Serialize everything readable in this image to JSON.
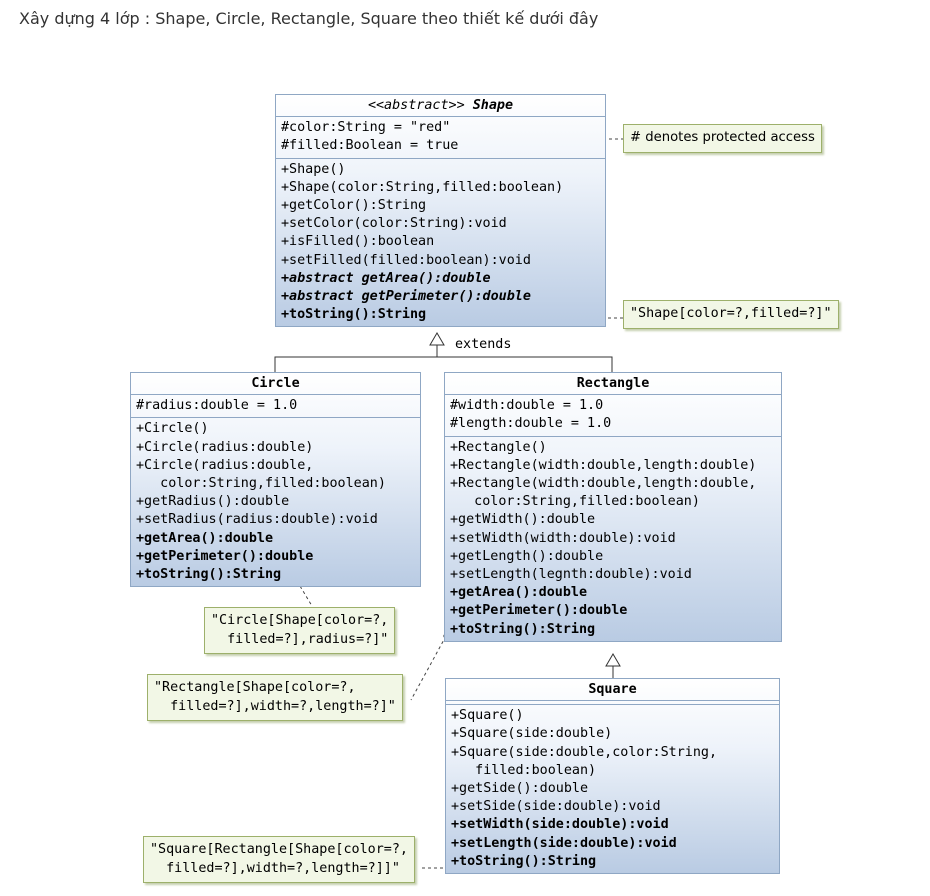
{
  "heading": "Xây dựng 4 lớp : Shape, Circle, Rectangle, Square theo thiết kế dưới đây",
  "shape": {
    "stereotype": "<<abstract>>",
    "name": "Shape",
    "attributes": [
      "#color:String = \"red\"",
      "#filled:Boolean = true"
    ],
    "methods": [
      {
        "text": "+Shape()",
        "style": ""
      },
      {
        "text": "+Shape(color:String,filled:boolean)",
        "style": ""
      },
      {
        "text": "+getColor():String",
        "style": ""
      },
      {
        "text": "+setColor(color:String):void",
        "style": ""
      },
      {
        "text": "+isFilled():boolean",
        "style": ""
      },
      {
        "text": "+setFilled(filled:boolean):void",
        "style": ""
      },
      {
        "text": "+abstract getArea():double",
        "style": "bi"
      },
      {
        "text": "+abstract getPerimeter():double",
        "style": "bi"
      },
      {
        "text": "+toString():String",
        "style": "b"
      }
    ]
  },
  "circle": {
    "name": "Circle",
    "attributes": [
      "#radius:double = 1.0"
    ],
    "methods": [
      {
        "text": "+Circle()",
        "style": ""
      },
      {
        "text": "+Circle(radius:double)",
        "style": ""
      },
      {
        "text": "+Circle(radius:double,",
        "style": ""
      },
      {
        "text": "   color:String,filled:boolean)",
        "style": ""
      },
      {
        "text": "+getRadius():double",
        "style": ""
      },
      {
        "text": "+setRadius(radius:double):void",
        "style": ""
      },
      {
        "text": "+getArea():double",
        "style": "b"
      },
      {
        "text": "+getPerimeter():double",
        "style": "b"
      },
      {
        "text": "+toString():String",
        "style": "b"
      }
    ]
  },
  "rectangle": {
    "name": "Rectangle",
    "attributes": [
      "#width:double = 1.0",
      "#length:double = 1.0"
    ],
    "methods": [
      {
        "text": "+Rectangle()",
        "style": ""
      },
      {
        "text": "+Rectangle(width:double,length:double)",
        "style": ""
      },
      {
        "text": "+Rectangle(width:double,length:double,",
        "style": ""
      },
      {
        "text": "   color:String,filled:boolean)",
        "style": ""
      },
      {
        "text": "+getWidth():double",
        "style": ""
      },
      {
        "text": "+setWidth(width:double):void",
        "style": ""
      },
      {
        "text": "+getLength():double",
        "style": ""
      },
      {
        "text": "+setLength(legnth:double):void",
        "style": ""
      },
      {
        "text": "+getArea():double",
        "style": "b"
      },
      {
        "text": "+getPerimeter():double",
        "style": "b"
      },
      {
        "text": "+toString():String",
        "style": "b"
      }
    ]
  },
  "square": {
    "name": "Square",
    "methods": [
      {
        "text": "+Square()",
        "style": ""
      },
      {
        "text": "+Square(side:double)",
        "style": ""
      },
      {
        "text": "+Square(side:double,color:String,",
        "style": ""
      },
      {
        "text": "   filled:boolean)",
        "style": ""
      },
      {
        "text": "+getSide():double",
        "style": ""
      },
      {
        "text": "+setSide(side:double):void",
        "style": ""
      },
      {
        "text": "+setWidth(side:double):void",
        "style": "b"
      },
      {
        "text": "+setLength(side:double):void",
        "style": "b"
      },
      {
        "text": "+toString():String",
        "style": "b"
      }
    ]
  },
  "notes": {
    "protected": "# denotes protected access",
    "shape_tostring": "\"Shape[color=?,filled=?]\"",
    "circle_tostring": "\"Circle[Shape[color=?,\n  filled=?],radius=?]\"",
    "rectangle_tostring": "\"Rectangle[Shape[color=?,\n  filled=?],width=?,length=?]\"",
    "square_tostring": "\"Square[Rectangle[Shape[color=?,\n  filled=?],width=?,length=?]]\""
  },
  "extends_label": "extends"
}
